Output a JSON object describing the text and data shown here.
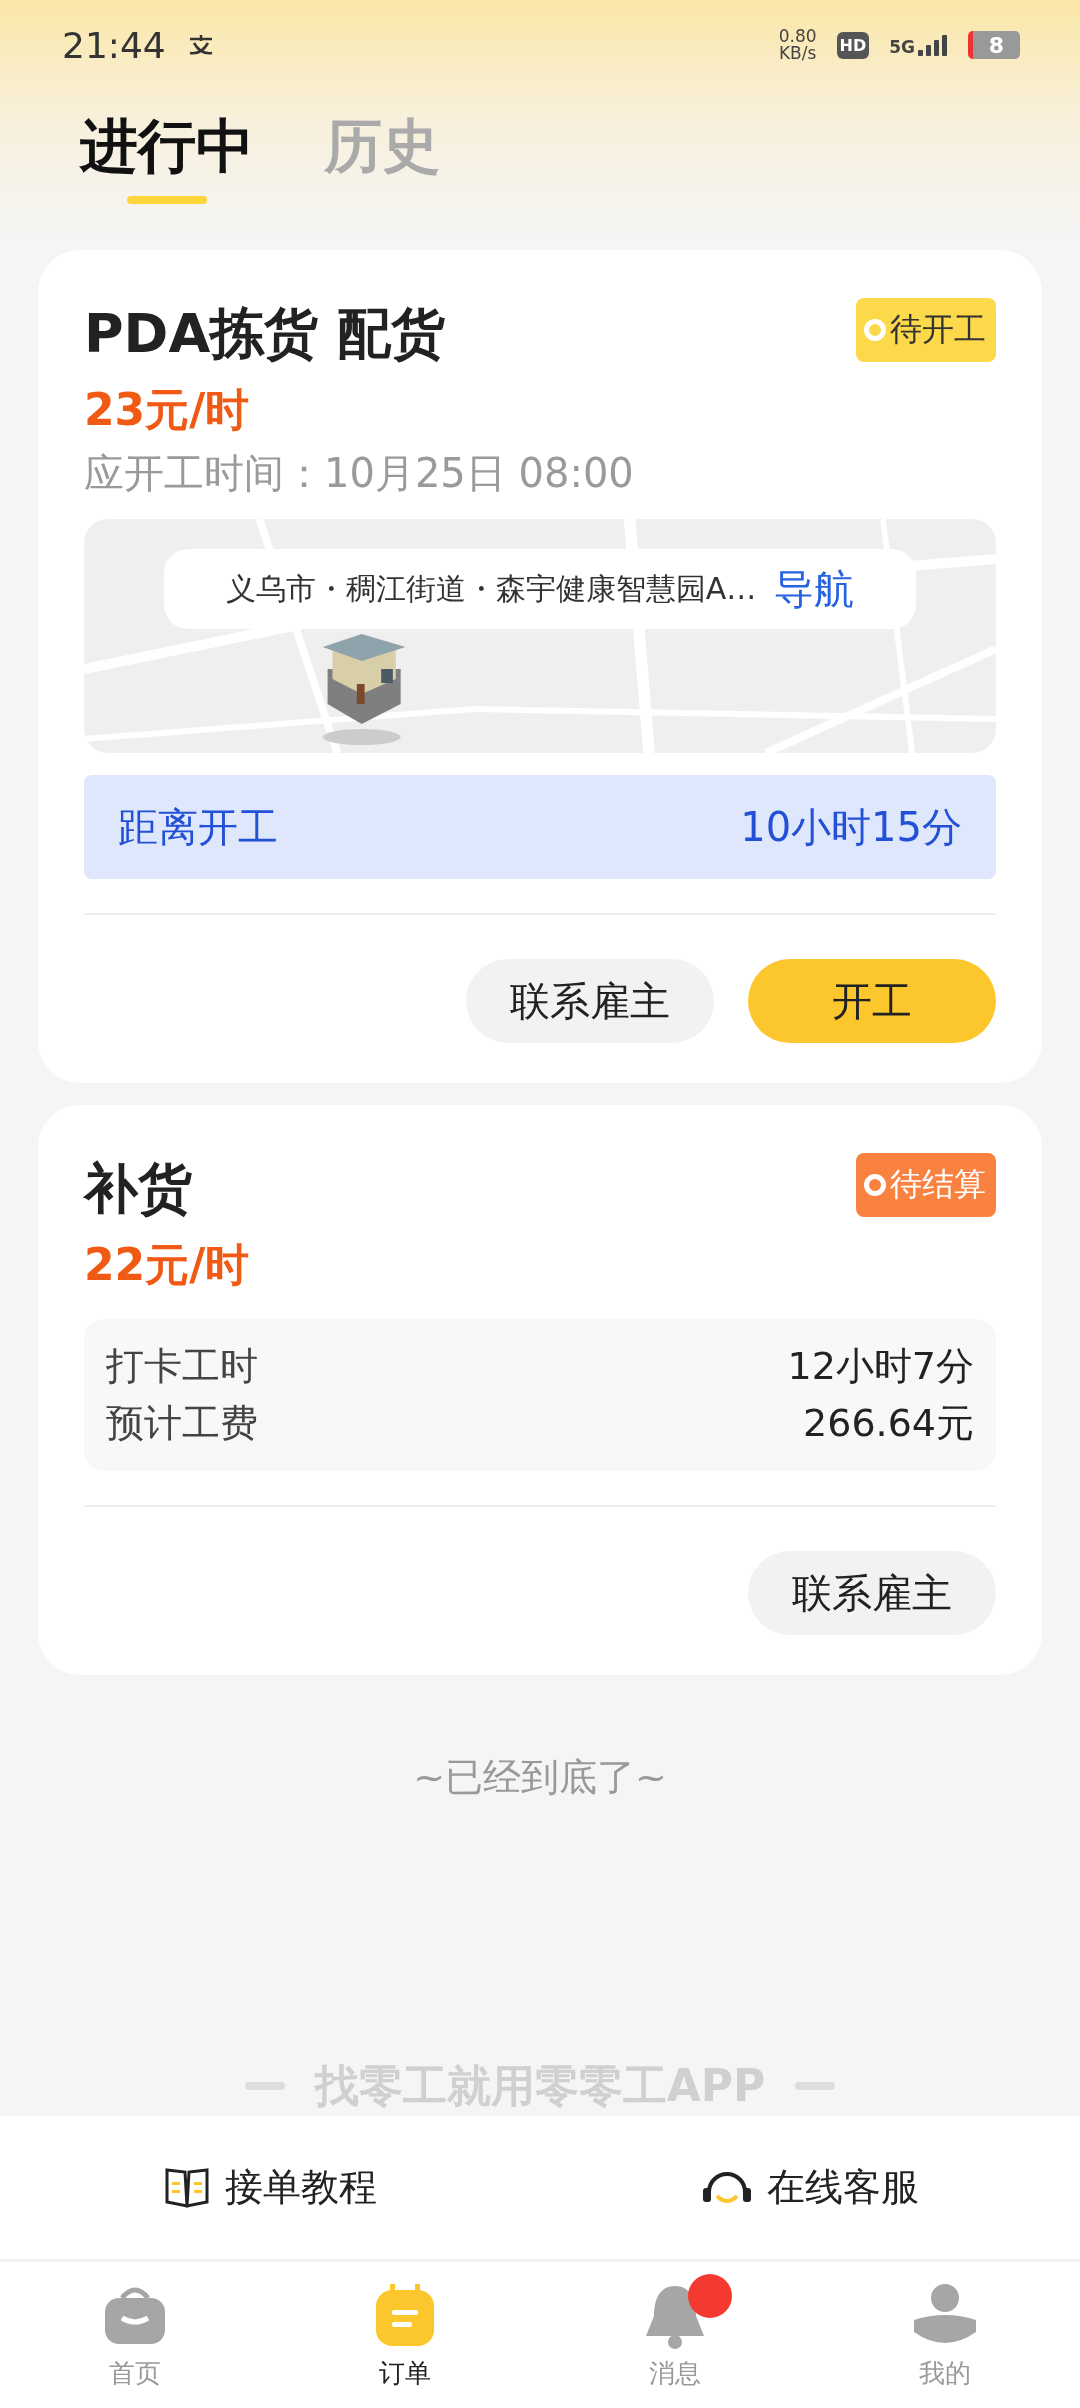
{
  "status_bar": {
    "time": "21:44",
    "speed": "0.80",
    "speed_unit": "KB/s",
    "hd": "HD",
    "network": "5G",
    "battery": "8"
  },
  "tabs": [
    {
      "label": "进行中",
      "selected": true
    },
    {
      "label": "历史",
      "selected": false
    }
  ],
  "orders": [
    {
      "title": "PDA拣货 配货",
      "status": {
        "label": "待开工",
        "color": "#fcd94a"
      },
      "rate": "23元/时",
      "start_time": "应开工时间：10月25日 08:00",
      "location": {
        "address": "义乌市・稠江街道・森宇健康智慧园A…",
        "nav_label": "导航"
      },
      "countdown": {
        "label": "距离开工",
        "value": "10小时15分"
      },
      "actions": [
        {
          "label": "联系雇主",
          "kind": "secondary"
        },
        {
          "label": "开工",
          "kind": "primary"
        }
      ]
    },
    {
      "title": "补货",
      "status": {
        "label": "待结算",
        "color": "#fa8240"
      },
      "rate": "22元/时",
      "stats": [
        {
          "label": "打卡工时",
          "value": "12小时7分"
        },
        {
          "label": "预计工费",
          "value": "266.64元"
        }
      ],
      "actions": [
        {
          "label": "联系雇主",
          "kind": "secondary"
        }
      ]
    }
  ],
  "end_note": "~已经到底了~",
  "slogan": "找零工就用零零工APP",
  "helper_links": [
    {
      "label": "接单教程",
      "kind": "guide"
    },
    {
      "label": "在线客服",
      "kind": "support"
    }
  ],
  "nav": [
    {
      "label": "首页",
      "selected": false,
      "badge": false
    },
    {
      "label": "订单",
      "selected": true,
      "badge": false
    },
    {
      "label": "消息",
      "selected": false,
      "badge": true
    },
    {
      "label": "我的",
      "selected": false,
      "badge": false
    }
  ]
}
